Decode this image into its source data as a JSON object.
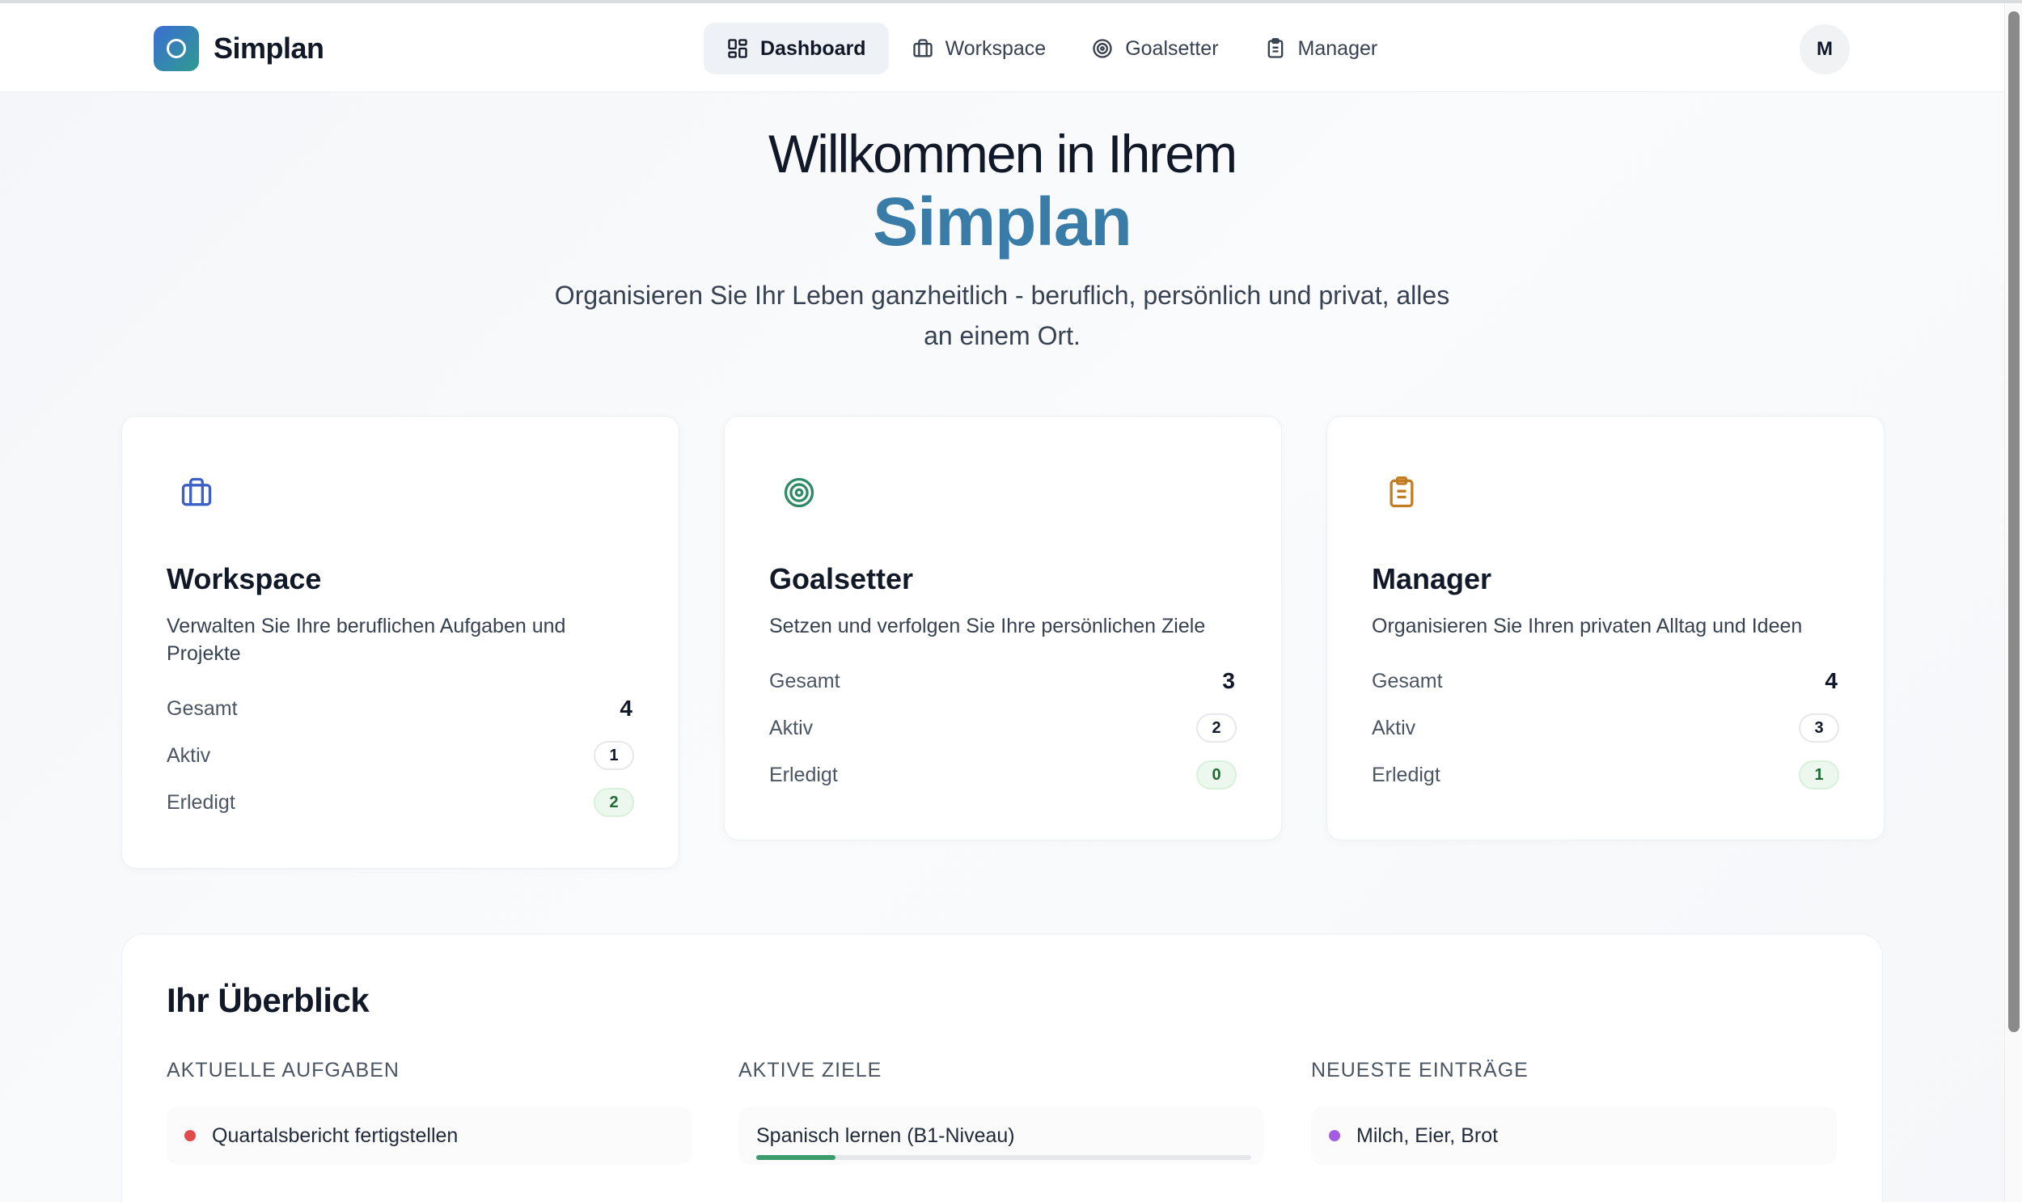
{
  "app": {
    "name": "Simplan",
    "avatar_initial": "M"
  },
  "nav": {
    "items": [
      {
        "label": "Dashboard",
        "icon": "grid-icon",
        "active": true
      },
      {
        "label": "Workspace",
        "icon": "briefcase-icon",
        "active": false
      },
      {
        "label": "Goalsetter",
        "icon": "target-icon",
        "active": false
      },
      {
        "label": "Manager",
        "icon": "clipboard-icon",
        "active": false
      }
    ]
  },
  "hero": {
    "title": "Willkommen in Ihrem",
    "brand": "Simplan",
    "subtitle": "Organisieren Sie Ihr Leben ganzheitlich - beruflich, persönlich und privat, alles an einem Ort."
  },
  "cards": [
    {
      "title": "Workspace",
      "description": "Verwalten Sie Ihre beruflichen Aufgaben und Projekte",
      "icon": "briefcase-icon",
      "icon_color": "#3b5fc4",
      "stats": {
        "total_label": "Gesamt",
        "total": "4",
        "active_label": "Aktiv",
        "active": "1",
        "done_label": "Erledigt",
        "done": "2"
      }
    },
    {
      "title": "Goalsetter",
      "description": "Setzen und verfolgen Sie Ihre persönlichen Ziele",
      "icon": "target-icon",
      "icon_color": "#2f8a66",
      "stats": {
        "total_label": "Gesamt",
        "total": "3",
        "active_label": "Aktiv",
        "active": "2",
        "done_label": "Erledigt",
        "done": "0"
      }
    },
    {
      "title": "Manager",
      "description": "Organisieren Sie Ihren privaten Alltag und Ideen",
      "icon": "clipboard-icon",
      "icon_color": "#c27c22",
      "stats": {
        "total_label": "Gesamt",
        "total": "4",
        "active_label": "Aktiv",
        "active": "3",
        "done_label": "Erledigt",
        "done": "1"
      }
    }
  ],
  "overview": {
    "title": "Ihr Überblick",
    "tasks": {
      "heading": "AKTUELLE AUFGABEN",
      "items": [
        {
          "label": "Quartalsbericht fertigstellen",
          "dot_color": "#e04b4b"
        }
      ]
    },
    "goals": {
      "heading": "AKTIVE ZIELE",
      "items": [
        {
          "label": "Spanisch lernen (B1-Niveau)",
          "progress": 0.16
        }
      ]
    },
    "entries": {
      "heading": "NEUESTE EINTRÄGE",
      "items": [
        {
          "label": "Milch, Eier, Brot",
          "dot_color": "#a45de0"
        }
      ]
    }
  }
}
